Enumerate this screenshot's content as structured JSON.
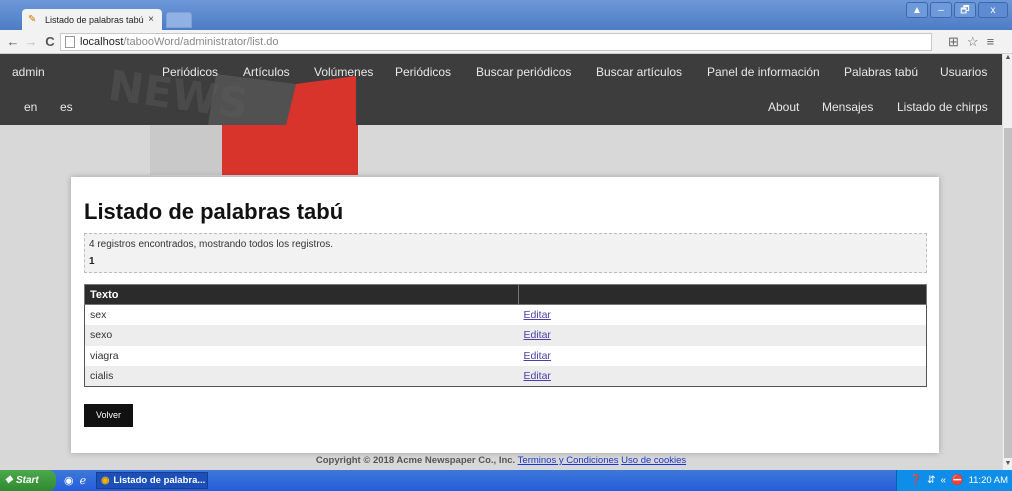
{
  "browser": {
    "tab_title": "Listado de palabras tabú",
    "tab_close": "×",
    "url_host": "localhost",
    "url_path": "/tabooWord/administrator/list.do",
    "back_glyph": "←",
    "forward_glyph": "→",
    "reload_glyph": "C",
    "window_controls": {
      "restore_up": "▲",
      "minimize": "–",
      "maximize": "🗗",
      "close": "x"
    }
  },
  "nav": {
    "row1": [
      "admin",
      "Periódicos",
      "Artículos",
      "Volúmenes",
      "Periódicos",
      "Buscar periódicos",
      "Buscar artículos",
      "Panel de información",
      "Palabras tabú",
      "Usuarios"
    ],
    "row2_left": [
      "en",
      "es"
    ],
    "row2_right": [
      "About",
      "Mensajes",
      "Listado de chirps"
    ]
  },
  "page": {
    "title": "Listado de palabras tabú",
    "records_text": "4 registros encontrados, mostrando todos los registros.",
    "page_number": "1",
    "table": {
      "headers": [
        "Texto",
        ""
      ],
      "rows": [
        {
          "text": "sex",
          "action": "Editar"
        },
        {
          "text": "sexo",
          "action": "Editar"
        },
        {
          "text": "viagra",
          "action": "Editar"
        },
        {
          "text": "cialis",
          "action": "Editar"
        }
      ]
    },
    "back_label": "Volver"
  },
  "footer": {
    "copyright": "Copyright © 2018 Acme Newspaper Co., Inc.",
    "terms": "Terminos y Condiciones",
    "cookies": "Uso de cookies"
  },
  "taskbar": {
    "start": "Start",
    "task_item": "Listado de palabra...",
    "clock": "11:20 AM"
  },
  "colors": {
    "header_bg": "#3d3d3d",
    "accent_red": "#d9342c",
    "link": "#4b3fa8"
  }
}
